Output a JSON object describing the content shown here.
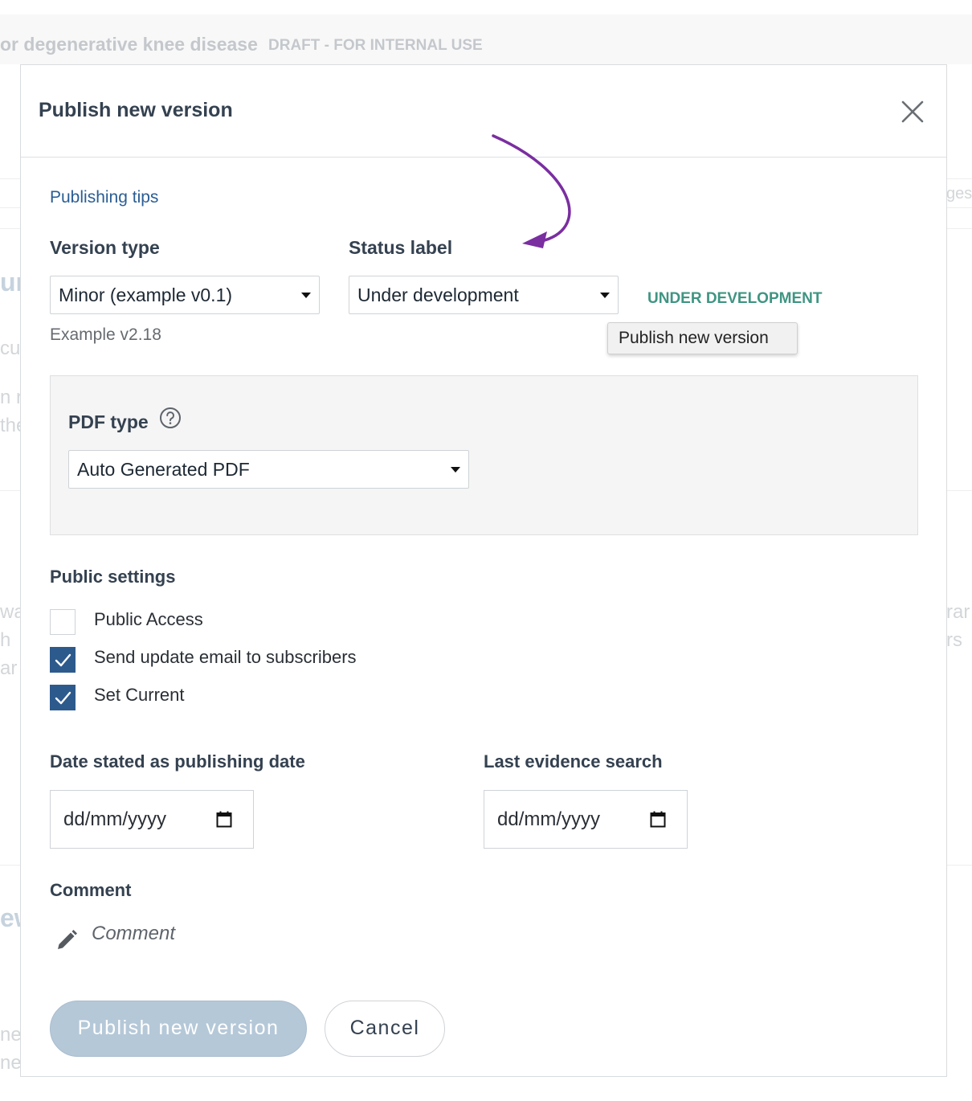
{
  "background": {
    "page_title": "or degenerative knee disease",
    "draft_label": "DRAFT - FOR INTERNAL USE",
    "right_fragments": [
      "ges",
      "rar",
      "rs"
    ],
    "left_fragments": [
      "un",
      "cu",
      "n r",
      "the",
      "wa",
      "h",
      "ar",
      "ew",
      "ner",
      "ner"
    ]
  },
  "modal": {
    "title": "Publish new version",
    "close_icon": "close-icon",
    "publishing_tips_link": "Publishing tips",
    "version_type": {
      "label": "Version type",
      "selected": "Minor (example v0.1)",
      "example": "Example v2.18"
    },
    "status_label": {
      "label": "Status label",
      "selected": "Under development",
      "badge": "UNDER DEVELOPMENT",
      "badge_color": "#3f9582"
    },
    "tooltip": "Publish new version",
    "pdf_type": {
      "label": "PDF type",
      "selected": "Auto Generated PDF",
      "help_icon": "help-circle-icon"
    },
    "public_settings": {
      "heading": "Public settings",
      "options": [
        {
          "label": "Public Access",
          "checked": false
        },
        {
          "label": "Send update email to subscribers",
          "checked": true
        },
        {
          "label": "Set Current",
          "checked": true
        }
      ]
    },
    "publishing_date": {
      "label": "Date stated as publishing date",
      "placeholder": "dd/mm/yyyy"
    },
    "last_evidence_search": {
      "label": "Last evidence search",
      "placeholder": "dd/mm/yyyy"
    },
    "comment": {
      "label": "Comment",
      "placeholder": "Comment",
      "icon": "pencil-icon"
    },
    "buttons": {
      "publish": "Publish new version",
      "cancel": "Cancel"
    },
    "colors": {
      "primary": "#2d5a8c",
      "link": "#2a5d94",
      "annotation_arrow": "#7a2ea0",
      "publish_disabled": "#b5c8d8"
    }
  }
}
